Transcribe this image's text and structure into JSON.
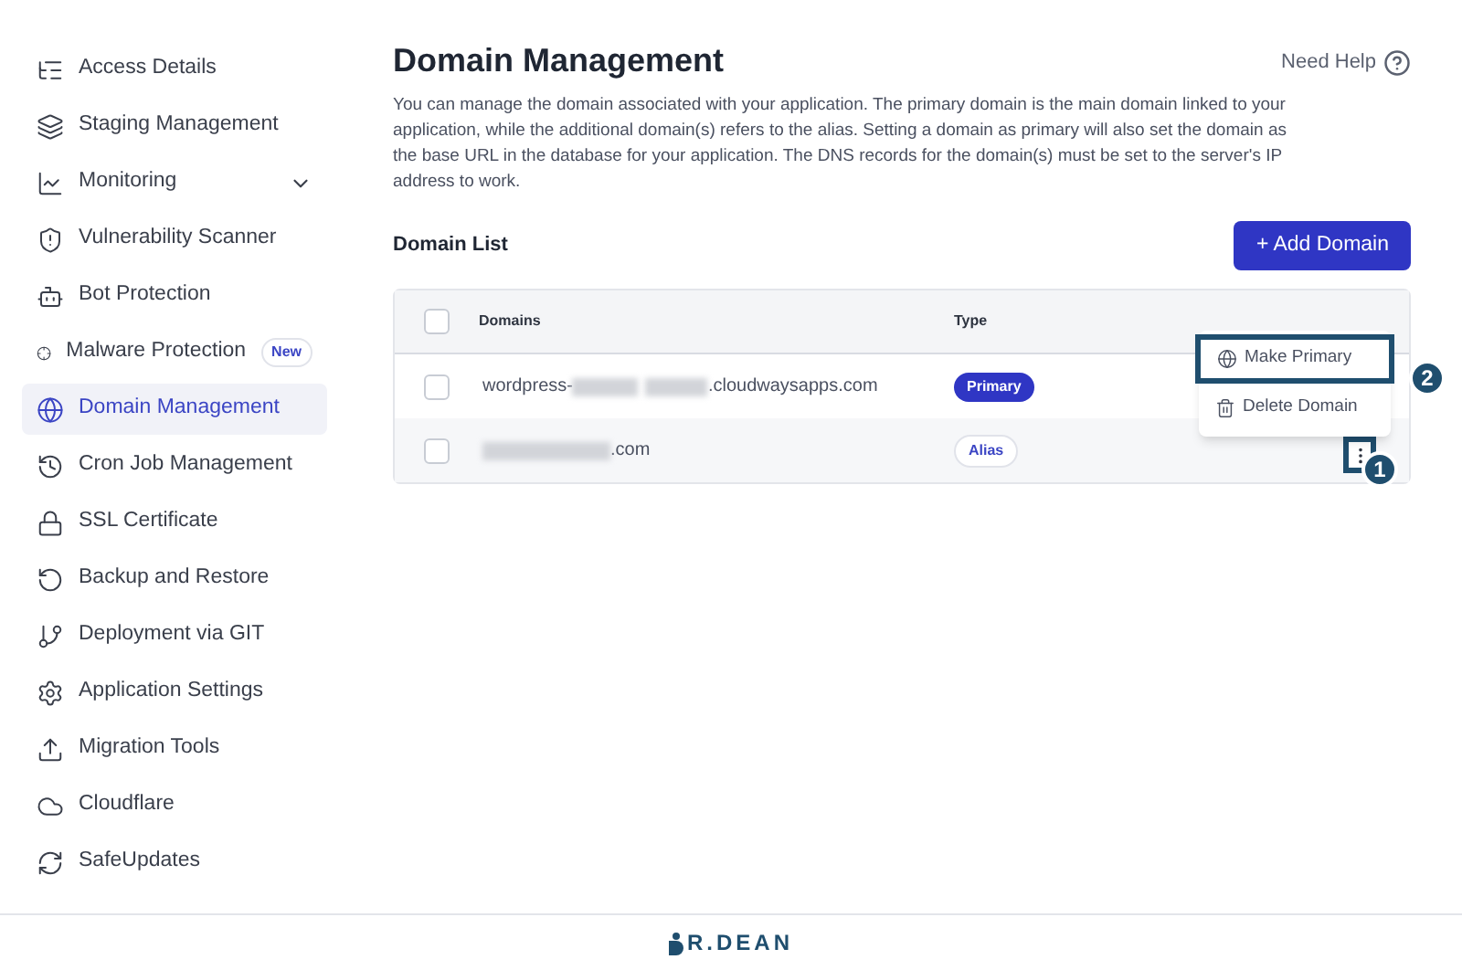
{
  "sidebar": {
    "items": [
      {
        "label": "Access Details",
        "kind": "access",
        "selected": false
      },
      {
        "label": "Staging Management",
        "kind": "layers",
        "selected": false
      },
      {
        "label": "Monitoring",
        "kind": "chart",
        "selected": false,
        "expanded": false
      },
      {
        "label": "Vulnerability Scanner",
        "kind": "shield",
        "selected": false
      },
      {
        "label": "Bot Protection",
        "kind": "bot",
        "selected": false
      },
      {
        "label": "Malware Protection",
        "kind": "target",
        "selected": false,
        "badge": "New"
      },
      {
        "label": "Domain Management",
        "kind": "globe",
        "selected": true
      },
      {
        "label": "Cron Job Management",
        "kind": "history",
        "selected": false
      },
      {
        "label": "SSL Certificate",
        "kind": "lock",
        "selected": false
      },
      {
        "label": "Backup and Restore",
        "kind": "restore",
        "selected": false
      },
      {
        "label": "Deployment via GIT",
        "kind": "git",
        "selected": false
      },
      {
        "label": "Application Settings",
        "kind": "gear",
        "selected": false
      },
      {
        "label": "Migration Tools",
        "kind": "upload",
        "selected": false
      },
      {
        "label": "Cloudflare",
        "kind": "cloud",
        "selected": false
      },
      {
        "label": "SafeUpdates",
        "kind": "refresh",
        "selected": false
      }
    ]
  },
  "header": {
    "title": "Domain Management",
    "help": "Need Help",
    "description": "You can manage the domain associated with your application. The primary domain is the main domain linked to your application, while the additional domain(s) refers to the alias. Setting a domain as primary will also set the domain as the base URL in the database for your application. The DNS records for the domain(s) must be set to the server's IP address to work."
  },
  "domain_list": {
    "title": "Domain List",
    "add_button": "+ Add Domain",
    "columns": [
      "Domains",
      "Type"
    ],
    "header_checked": false,
    "rows": [
      {
        "prefix": "wordpress-",
        "redacted": true,
        "suffix": ".cloudwaysapps.com",
        "type": "Primary",
        "kind": "primary",
        "checked": false
      },
      {
        "redacted": true,
        "suffix": ".com",
        "type": "Alias",
        "kind": "alias",
        "checked": false
      }
    ]
  },
  "menu": {
    "items": [
      {
        "label": "Make Primary",
        "kind": "globe",
        "highlighted": true
      },
      {
        "label": "Delete Domain",
        "kind": "trash",
        "highlighted": false
      }
    ]
  },
  "callouts": [
    "1",
    "2"
  ],
  "footer": {
    "logo": "R.DEAN"
  }
}
